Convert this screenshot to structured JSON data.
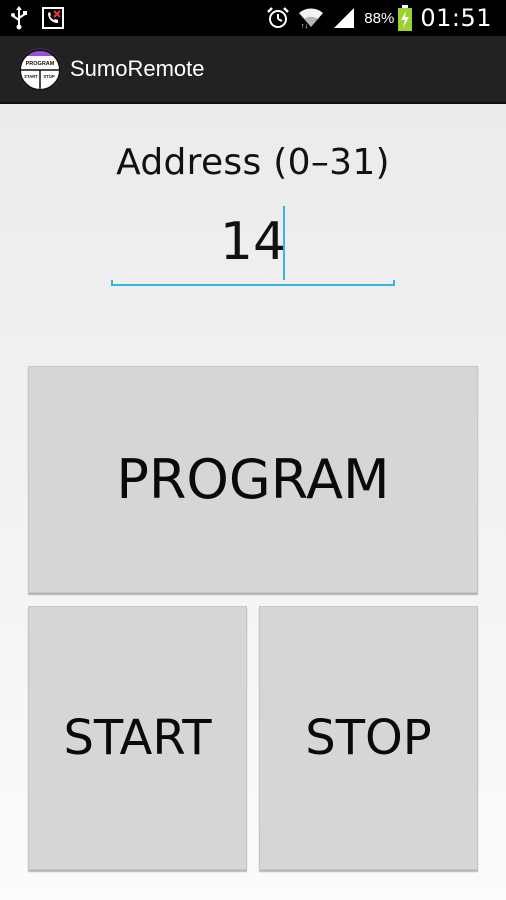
{
  "status_bar": {
    "battery_percent": "88%",
    "time": "01:51",
    "icons_left": [
      "usb-icon",
      "missed-call-icon"
    ],
    "icons_right": [
      "alarm-icon",
      "wifi-icon",
      "signal-icon",
      "battery-charging-icon"
    ]
  },
  "action_bar": {
    "title": "SumoRemote",
    "icon": {
      "name": "app-icon",
      "label_top": "PROGRAM",
      "label_left": "START",
      "label_right": "STOP"
    }
  },
  "address": {
    "label": "Address (0–31)",
    "value": "14"
  },
  "buttons": {
    "program": "PROGRAM",
    "start": "START",
    "stop": "STOP"
  },
  "colors": {
    "accent": "#33b5e5",
    "action_bar_bg": "#222222",
    "status_bar_bg": "#000000",
    "button_bg": "#d6d6d6",
    "app_icon_accent": "#9b4fd6"
  }
}
